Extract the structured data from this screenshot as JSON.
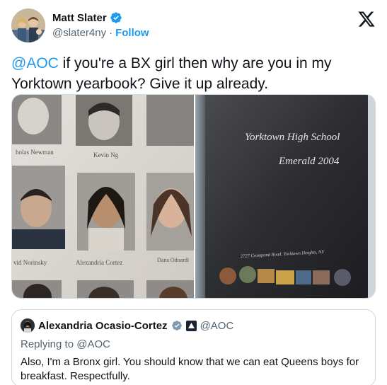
{
  "author": {
    "name": "Matt Slater",
    "handle": "@slater4ny",
    "separator": "·",
    "follow_label": "Follow"
  },
  "tweet": {
    "mention": "@AOC",
    "text": " if you're a BX girl then why are you in my Yorktown yearbook? Give it up already."
  },
  "media": {
    "left_photo": {
      "names": [
        "holas Newman",
        "Kevin Ng",
        "vid Norinsky",
        "Alexandria Cortez",
        "Dana Odoardi"
      ]
    },
    "right_photo": {
      "cover_title": "Yorktown High School",
      "cover_subtitle": "Emerald 2004",
      "cover_address": "2727 Crompond Road, Yorktown Heights, NY"
    }
  },
  "quote": {
    "name": "Alexandria Ocasio-Cortez",
    "handle": "@AOC",
    "replying_to": "Replying to @AOC",
    "text": "Also, I'm a Bronx girl. You should know that we can eat Queens boys for breakfast. Respectfully."
  },
  "colors": {
    "accent": "#1d9bf0",
    "text": "#0f1419",
    "muted": "#536471",
    "border": "#cfd9de"
  },
  "icons": [
    "verified-badge-icon",
    "x-logo-icon",
    "government-affiliation-icon"
  ]
}
